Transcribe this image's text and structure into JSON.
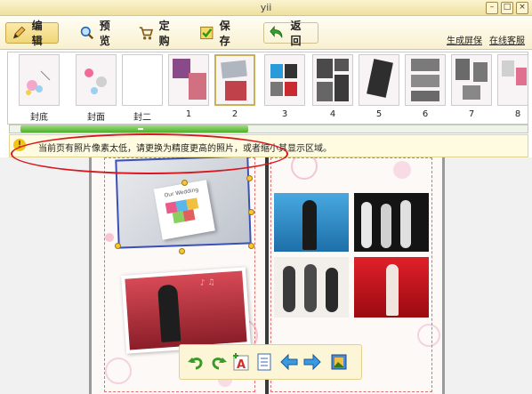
{
  "window": {
    "title": "yii"
  },
  "toolbar": {
    "edit_label": "编 辑",
    "preview_label": "预 览",
    "order_label": "定 购",
    "save_label": "保 存",
    "back_label": "返 回",
    "link_screen": "生成屏保",
    "link_service": "在线客服"
  },
  "thumbnails": [
    {
      "label": "封底"
    },
    {
      "label": "封面"
    },
    {
      "label": "封二"
    },
    {
      "label": "1"
    },
    {
      "label": "2"
    },
    {
      "label": "3"
    },
    {
      "label": "4"
    },
    {
      "label": "5"
    },
    {
      "label": "6"
    },
    {
      "label": "7"
    },
    {
      "label": "8"
    }
  ],
  "warning": {
    "icon": "warning-icon",
    "text": "当前页有照片像素太低，请更换为精度更高的照片，或者缩小其显示区域。"
  },
  "page": {
    "photo_caption": "Our Wedding"
  },
  "colors": {
    "accent": "#f1d77a",
    "warning_oval": "#d9171f",
    "progress": "#4fae2f"
  }
}
